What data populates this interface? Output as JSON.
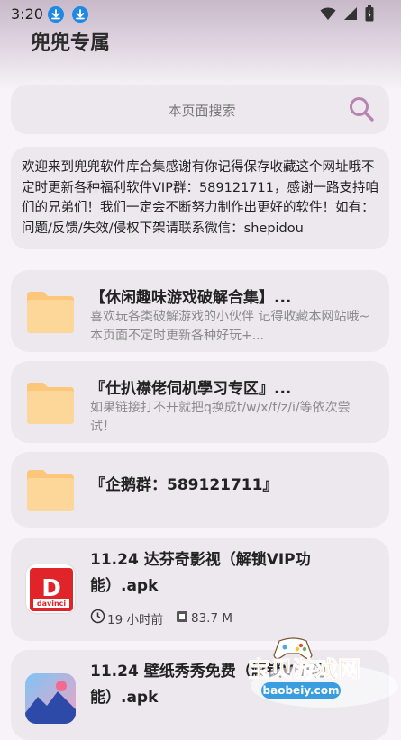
{
  "status_bar": {
    "time": "3:20"
  },
  "app": {
    "title": "兜兜专属"
  },
  "search": {
    "placeholder": "本页面搜索"
  },
  "notice": {
    "text": "欢迎来到兜兜软件库合集感谢有你记得保存收藏这个网址哦不定时更新各种福利软件VIP群：589121711，感谢一路支持咱们的兄弟们！我们一定会不断努力制作出更好的软件！如有：问题/反馈/失效/侵权下架请联系微信：shepidou"
  },
  "folders": [
    {
      "title": "【休闲趣味游戏破解合集】...",
      "desc": "喜欢玩各类破解游戏的小伙伴 记得收藏本网站哦~本页面不定时更新各种好玩+..."
    },
    {
      "title": "『仕扒襟佬伺机學习专区』...",
      "desc": "如果链接打不开就把q换成t/w/x/f/z/i/等依次尝试！"
    },
    {
      "title": "『企鹅群：589121711』",
      "desc": ""
    }
  ],
  "files": [
    {
      "title": "11.24 达芬奇影视（解锁VIP功能）.apk",
      "time": "19 小时前",
      "size": "83.7 M",
      "icon": "davinci-app-icon",
      "icon_text": "D",
      "icon_sub": "davinci"
    },
    {
      "title": "11.24 壁纸秀秀免费（解锁VIP功能）.apk",
      "icon": "wallpaper-app-icon"
    }
  ],
  "watermark": {
    "text": "宝贝游戏网",
    "url": "baobeiy.com"
  },
  "colors": {
    "card_bg": "#ece8ee",
    "folder": "#fdd08a",
    "accent": "#b784b0",
    "download_badge": "#1e88e5",
    "davinci_red": "#e0242a"
  }
}
